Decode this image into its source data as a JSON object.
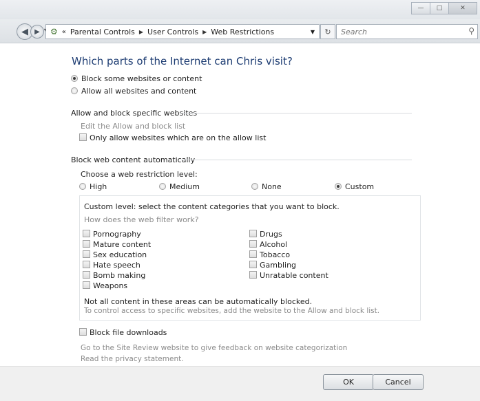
{
  "address_bar": {
    "crumbs": [
      "Parental Controls",
      "User Controls",
      "Web Restrictions"
    ],
    "search_placeholder": "Search"
  },
  "page": {
    "heading": "Which parts of the Internet can Chris visit?",
    "block_option": "Block some websites or content",
    "allow_option": "Allow all websites and content",
    "allow_block_section": "Allow and block specific websites",
    "edit_list_link": "Edit the Allow and block list",
    "only_allow_label": "Only allow websites which are on the allow list",
    "block_auto_section": "Block web content automatically",
    "choose_level": "Choose a web restriction level:",
    "levels": [
      "High",
      "Medium",
      "None",
      "Custom"
    ],
    "selected_level": "Custom",
    "custom_intro": "Custom level:  select the content categories that you want to block.",
    "filter_link": "How does the web filter work?",
    "categories_left": [
      "Pornography",
      "Mature content",
      "Sex education",
      "Hate speech",
      "Bomb making",
      "Weapons"
    ],
    "categories_right": [
      "Drugs",
      "Alcohol",
      "Tobacco",
      "Gambling",
      "Unratable content"
    ],
    "note1": "Not all content in these areas can be automatically blocked.",
    "note2": "To control access to specific websites, add the website to the Allow and block list.",
    "block_downloads": "Block file downloads",
    "site_review_link": "Go to the Site Review website to give feedback on website categorization",
    "privacy_link": "Read the privacy statement."
  },
  "buttons": {
    "ok": "OK",
    "cancel": "Cancel"
  }
}
